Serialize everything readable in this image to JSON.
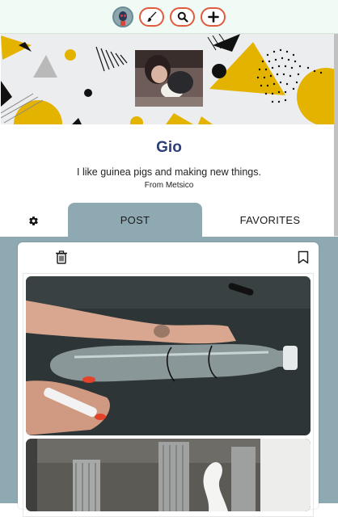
{
  "nav": {
    "avatar_icon": "alien-avatar-icon",
    "buttons": [
      {
        "icon": "brush-icon"
      },
      {
        "icon": "search-icon"
      },
      {
        "icon": "plus-icon"
      }
    ],
    "accent_color": "#e05a3d"
  },
  "profile": {
    "name": "Gio",
    "bio": "I like guinea pigs and making new things.",
    "from": "From Metsico"
  },
  "tabs": {
    "settings_icon": "gear-icon",
    "post_label": "POST",
    "favorites_label": "FAVORITES",
    "active_color": "#8ea9b1"
  },
  "post": {
    "delete_icon": "trash-icon",
    "bookmark_icon": "bookmark-icon",
    "images": [
      {
        "alt": "hands marking a plastic bottle with a marker"
      },
      {
        "alt": "kitchen utensil holders and paper roll"
      }
    ]
  }
}
